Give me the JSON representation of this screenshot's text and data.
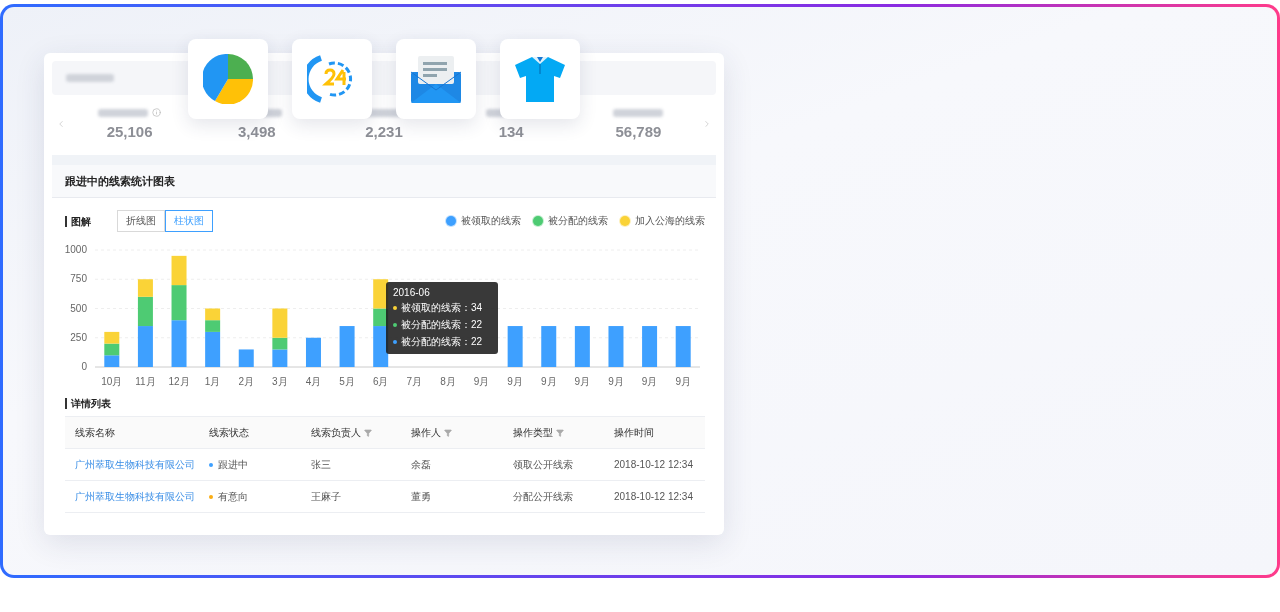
{
  "floating_icons": [
    {
      "kind": "pie"
    },
    {
      "kind": "support"
    },
    {
      "kind": "mail"
    },
    {
      "kind": "shirt"
    }
  ],
  "stats": [
    {
      "value": "25,106",
      "info": true
    },
    {
      "value": "3,498",
      "info": false
    },
    {
      "value": "2,231",
      "info": false
    },
    {
      "value": "134",
      "info": false
    },
    {
      "value": "56,789",
      "info": false
    }
  ],
  "chart_section": {
    "title": "跟进中的线索统计图表",
    "legend_heading": "图解",
    "tabs": [
      {
        "label": "折线图",
        "selected": false
      },
      {
        "label": "柱状图",
        "selected": true
      }
    ],
    "chart_data": {
      "type": "bar",
      "stacked": true,
      "grid": true,
      "categories": [
        "10月",
        "11月",
        "12月",
        "1月",
        "2月",
        "3月",
        "4月",
        "5月",
        "6月",
        "7月",
        "8月",
        "9月",
        "9月",
        "9月",
        "9月",
        "9月",
        "9月",
        "9月"
      ],
      "ylim": [
        0,
        1000
      ],
      "yticks": [
        0,
        250,
        500,
        750,
        1000
      ],
      "series": [
        {
          "name": "被领取的线索",
          "color": "#3ea0ff",
          "values": [
            100,
            350,
            400,
            300,
            150,
            150,
            250,
            350,
            350,
            null,
            null,
            null,
            350,
            350,
            350,
            350,
            350,
            350
          ]
        },
        {
          "name": "被分配的线索",
          "color": "#4ecb73",
          "values": [
            100,
            250,
            300,
            100,
            0,
            100,
            0,
            0,
            150,
            0,
            0,
            null,
            0,
            0,
            0,
            0,
            0,
            0
          ]
        },
        {
          "name": "加入公海的线索",
          "color": "#fad337",
          "values": [
            100,
            150,
            250,
            100,
            0,
            250,
            0,
            0,
            250,
            0,
            0,
            null,
            0,
            0,
            0,
            0,
            0,
            0
          ]
        }
      ]
    },
    "tooltip": {
      "title": "2016-06",
      "lines": [
        {
          "text": "被领取的线索：34",
          "color": "#fad337"
        },
        {
          "text": "被分配的线索：22",
          "color": "#4ecb73"
        },
        {
          "text": "被分配的线索：22",
          "color": "#3ea0ff"
        }
      ]
    }
  },
  "detail_table": {
    "heading": "详情列表",
    "columns": [
      {
        "label": "线索名称",
        "kind": "plain"
      },
      {
        "label": "线索状态",
        "kind": "plain"
      },
      {
        "label": "线索负责人",
        "kind": "filterable"
      },
      {
        "label": "操作人",
        "kind": "filterable"
      },
      {
        "label": "操作类型",
        "kind": "filterable"
      },
      {
        "label": "操作时间",
        "kind": "plain"
      }
    ],
    "rows": [
      {
        "name": "广州萃取生物科技有限公司",
        "status": "跟进中",
        "color": "#3ea0ff",
        "owner": "张三",
        "operator": "余磊",
        "type": "领取公开线索",
        "time": "2018-10-12 12:34"
      },
      {
        "name": "广州萃取生物科技有限公司",
        "status": "有意向",
        "color": "#faad14",
        "owner": "王麻子",
        "operator": "董勇",
        "type": "分配公开线索",
        "time": "2018-10-12 12:34"
      }
    ]
  }
}
